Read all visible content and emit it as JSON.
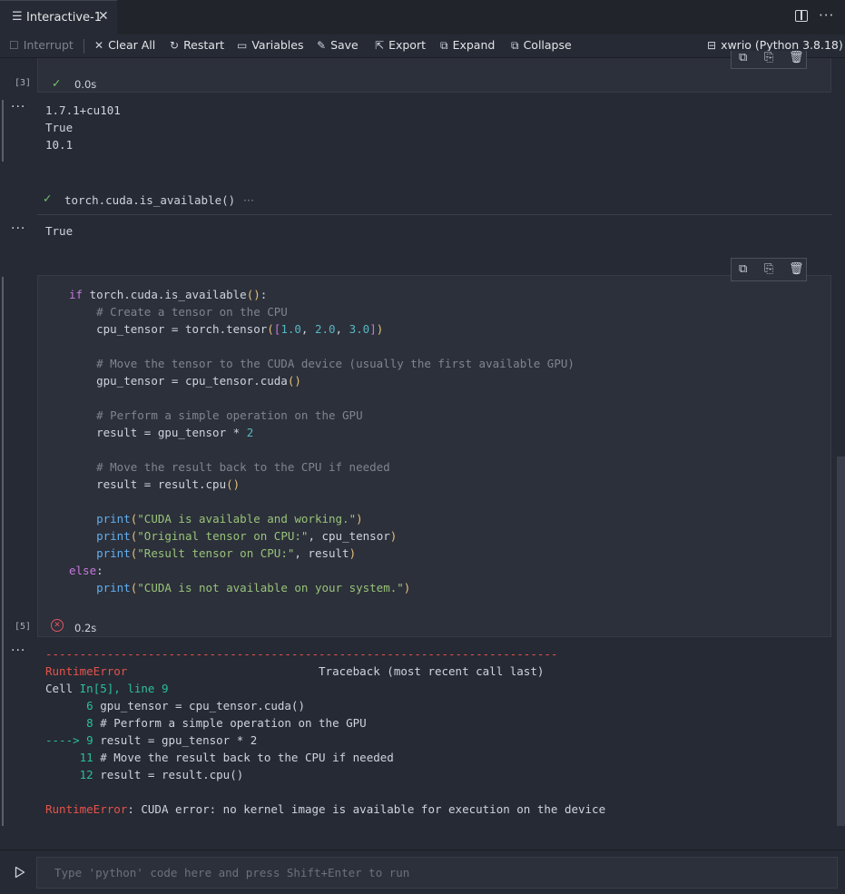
{
  "tab": {
    "label": "Interactive-1",
    "close": "✕"
  },
  "toolbar": {
    "interrupt": "Interrupt",
    "clear_all": "Clear All",
    "restart": "Restart",
    "variables": "Variables",
    "save": "Save",
    "export": "Export",
    "expand": "Expand",
    "collapse": "Collapse",
    "kernel": "xwrio (Python 3.8.18)"
  },
  "cell3": {
    "exec_count": "[3]",
    "duration": "0.0s",
    "output_lines": [
      "1.7.1+cu101",
      "True",
      "10.1"
    ]
  },
  "cell4": {
    "code_preview": "torch.cuda.is_available()",
    "more": "···",
    "output": "True"
  },
  "cell5": {
    "exec_count": "[5]",
    "duration": "0.2s",
    "code": {
      "l1_kw": "if",
      "l1_rest": " torch.cuda.is_available",
      "l1_p": "()",
      "l1_end": ":",
      "l2": "# Create a tensor on the CPU",
      "l3_a": "cpu_tensor = torch.tensor",
      "l3_p1": "(",
      "l3_b1": "[",
      "l3_n1": "1.0",
      "l3_c1": ", ",
      "l3_n2": "2.0",
      "l3_c2": ", ",
      "l3_n3": "3.0",
      "l3_b2": "]",
      "l3_p2": ")",
      "l5": "# Move the tensor to the CUDA device (usually the first available GPU)",
      "l6_a": "gpu_tensor = cpu_tensor.cuda",
      "l6_p": "()",
      "l8": "# Perform a simple operation on the GPU",
      "l9_a": "result = gpu_tensor * ",
      "l9_n": "2",
      "l11": "# Move the result back to the CPU if needed",
      "l12_a": "result = result.cpu",
      "l12_p": "()",
      "l14_f": "print",
      "l14_s": "\"CUDA is available and working.\"",
      "l15_f": "print",
      "l15_s": "\"Original tensor on CPU:\"",
      "l15_r": ", cpu_tensor",
      "l16_f": "print",
      "l16_s": "\"Result tensor on CPU:\"",
      "l16_r": ", result",
      "l17_kw": "else",
      "l17_end": ":",
      "l18_f": "print",
      "l18_s": "\"CUDA is not available on your system.\""
    },
    "traceback": {
      "dashes": "---------------------------------------------------------------------------",
      "error_name": "RuntimeError",
      "traceback_label": "Traceback (most recent call last)",
      "cell_prefix": "Cell ",
      "cell_ref": "In[5], line 9",
      "lines": [
        {
          "prefix": "      6",
          "text": " gpu_tensor = cpu_tensor.cuda()"
        },
        {
          "prefix": "      8",
          "text": " # Perform a simple operation on the GPU"
        },
        {
          "prefix": "----> 9",
          "text": " result = gpu_tensor * 2"
        },
        {
          "prefix": "     11",
          "text": " # Move the result back to the CPU if needed"
        },
        {
          "prefix": "     12",
          "text": " result = result.cpu()"
        }
      ],
      "final_error": "RuntimeError",
      "final_message": ": CUDA error: no kernel image is available for execution on the device"
    }
  },
  "input": {
    "placeholder": "Type 'python' code here and press Shift+Enter to run"
  },
  "colors": {
    "accent_success": "#78c26d",
    "accent_error": "#e05561",
    "traceback_green": "#2bbf9f"
  }
}
